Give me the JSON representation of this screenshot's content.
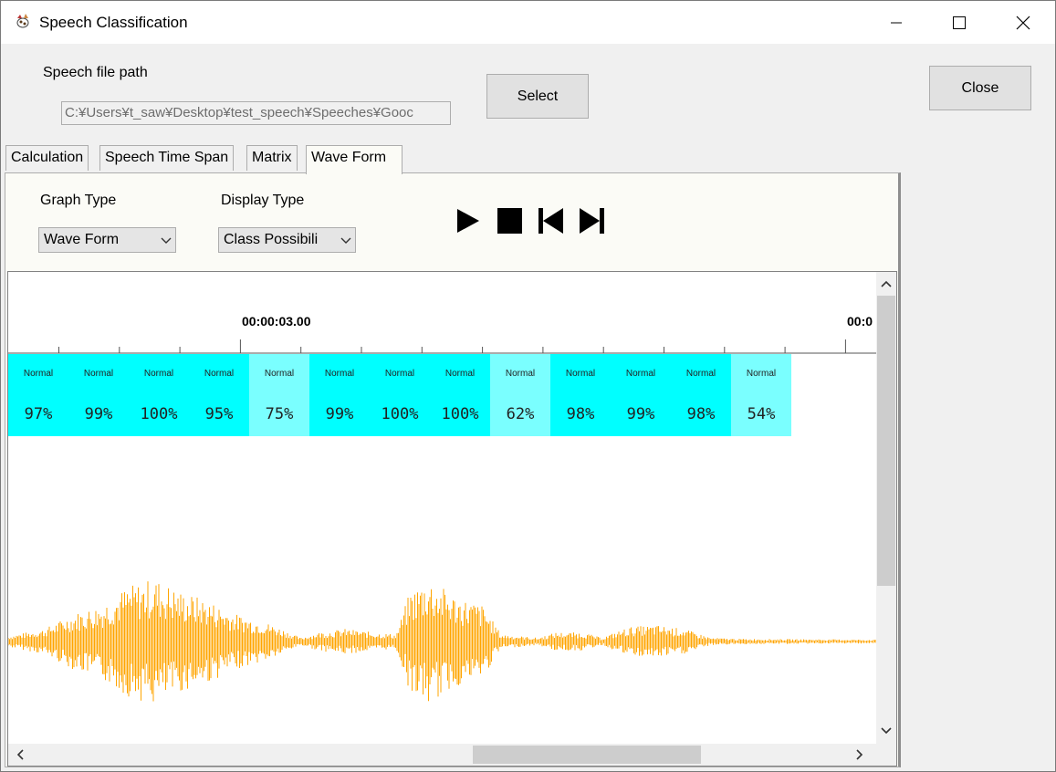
{
  "window": {
    "title": "Speech Classification"
  },
  "file": {
    "label": "Speech file path",
    "path": "C:¥Users¥t_saw¥Desktop¥test_speech¥Speeches¥Gooc"
  },
  "buttons": {
    "select": "Select",
    "close": "Close"
  },
  "tabs": [
    {
      "label": "Calculation"
    },
    {
      "label": "Speech Time Span"
    },
    {
      "label": "Matrix"
    },
    {
      "label": "Wave Form",
      "active": true
    }
  ],
  "controls": {
    "graph_type_label": "Graph Type",
    "graph_type_value": "Wave Form",
    "display_type_label": "Display Type",
    "display_type_value": "Class Possibili"
  },
  "timeline": {
    "marks": [
      "00:00:03.00",
      "00:0"
    ]
  },
  "classification": [
    {
      "cls": "Normal",
      "pct": "97%",
      "shade": "strong"
    },
    {
      "cls": "Normal",
      "pct": "99%",
      "shade": "strong"
    },
    {
      "cls": "Normal",
      "pct": "100%",
      "shade": "strong"
    },
    {
      "cls": "Normal",
      "pct": "95%",
      "shade": "strong"
    },
    {
      "cls": "Normal",
      "pct": "75%",
      "shade": "light"
    },
    {
      "cls": "Normal",
      "pct": "99%",
      "shade": "strong"
    },
    {
      "cls": "Normal",
      "pct": "100%",
      "shade": "strong"
    },
    {
      "cls": "Normal",
      "pct": "100%",
      "shade": "strong"
    },
    {
      "cls": "Normal",
      "pct": "62%",
      "shade": "light"
    },
    {
      "cls": "Normal",
      "pct": "98%",
      "shade": "strong"
    },
    {
      "cls": "Normal",
      "pct": "99%",
      "shade": "strong"
    },
    {
      "cls": "Normal",
      "pct": "98%",
      "shade": "strong"
    },
    {
      "cls": "Normal",
      "pct": "54%",
      "shade": "light"
    }
  ],
  "colors": {
    "strong": "#00ffff",
    "light": "#7affff",
    "wave": "#ffa500"
  },
  "icons": [
    "app-icon",
    "minimize-icon",
    "maximize-icon",
    "close-icon",
    "play-icon",
    "stop-icon",
    "skip-back-icon",
    "skip-forward-icon",
    "chevron-down-icon",
    "scroll-up-icon",
    "scroll-down-icon",
    "scroll-left-icon",
    "scroll-right-icon"
  ]
}
